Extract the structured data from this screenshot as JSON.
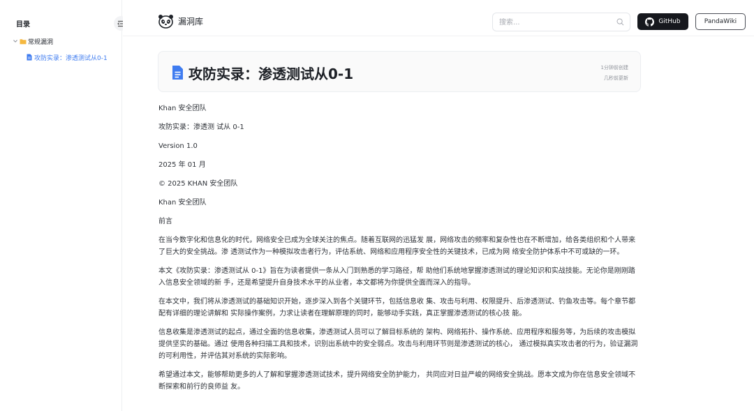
{
  "sidebar": {
    "title": "目录",
    "folder": {
      "label": "常规漏洞"
    },
    "doc": {
      "label": "攻防实录：渗透测试从0-1"
    }
  },
  "header": {
    "brand": "漏洞库",
    "search": {
      "placeholder": "搜索...",
      "value": ""
    },
    "github_label": "GitHub",
    "pandawiki_label": "PandaWiki"
  },
  "doc": {
    "title": "攻防实录：渗透测试从0-1",
    "created": "1分钟前创建",
    "updated": "几秒前更新",
    "lines": [
      "Khan 安全团队",
      "攻防实录：渗透测 试从 0-1",
      "Version 1.0",
      "2025 年 01 月",
      "© 2025 KHAN 安全团队",
      "Khan 安全团队",
      "前言"
    ],
    "paragraphs": [
      "在当今数字化和信息化的时代，网络安全已成为全球关注的焦点。随着互联网的迅猛发 展，网络攻击的频率和复杂性也在不断增加，给各类组织和个人带来了巨大的安全挑战。渗 透测试作为一种模拟攻击者行为，评估系统、网络和应用程序安全性的关键技术，已成为网 络安全防护体系中不可或缺的一环。",
      "本文《攻防实录：渗透测试从 0-1》旨在为读者提供一条从入门到熟悉的学习路径，帮 助他们系统地掌握渗透测试的理论知识和实战技能。无论你是刚刚踏入信息安全领域的新 手，还是希望提升自身技术水平的从业者，本文都将为你提供全面而深入的指导。",
      "在本文中，我们将从渗透测试的基础知识开始，逐步深入到各个关键环节，包括信息收 集、攻击与利用、权限提升、后渗透测试、钓鱼攻击等。每个章节都配有详细的理论讲解和 实际操作案例，力求让读者在理解原理的同时，能够动手实践，真正掌握渗透测试的核心技 能。",
      "信息收集是渗透测试的起点，通过全面的信息收集，渗透测试人员可以了解目标系统的 架构、网络拓扑、操作系统、应用程序和服务等，为后续的攻击模拟提供坚实的基础。通过 使用各种扫描工具和技术，识别出系统中的安全弱点。攻击与利用环节则是渗透测试的核心， 通过模拟真实攻击者的行为，验证漏洞的可利用性，并评估其对系统的实际影响。",
      "希望通过本文，能够帮助更多的人了解和掌握渗透测试技术，提升网络安全防护能力， 共同应对日益严峻的网络安全挑战。愿本文成为你在信息安全领域不断探索和前行的良师益 友。"
    ]
  },
  "colors": {
    "accent": "#3f7cf0",
    "github_bg": "#16181d",
    "folder": "#f5b840"
  }
}
